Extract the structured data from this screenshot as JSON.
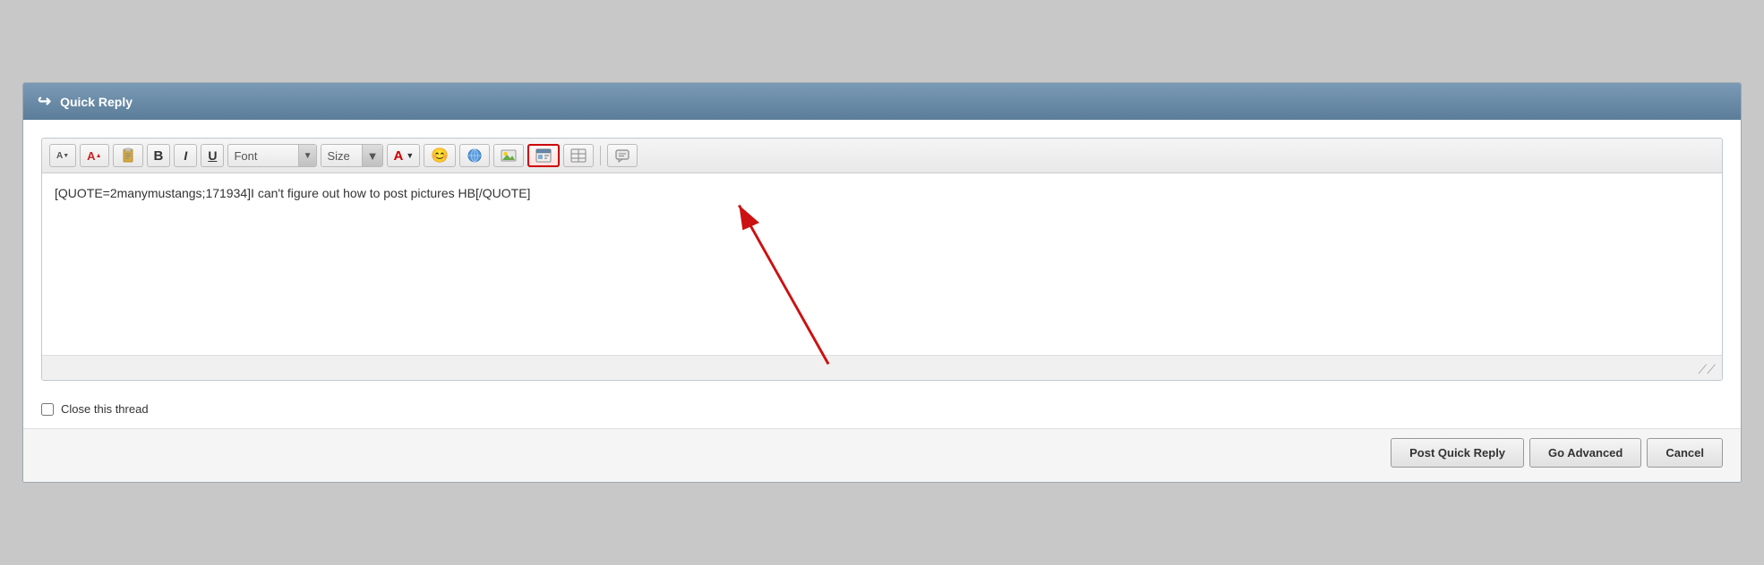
{
  "titleBar": {
    "icon": "↩",
    "title": "Quick Reply"
  },
  "toolbar": {
    "buttons": [
      {
        "name": "decrease-font-btn",
        "label": "A↓",
        "title": "Decrease Font Size"
      },
      {
        "name": "increase-font-btn",
        "label": "A↑",
        "title": "Increase Font Size"
      },
      {
        "name": "format-btn",
        "label": "📋",
        "title": "Format"
      },
      {
        "name": "bold-btn",
        "label": "B",
        "title": "Bold"
      },
      {
        "name": "italic-btn",
        "label": "I",
        "title": "Italic"
      },
      {
        "name": "underline-btn",
        "label": "U",
        "title": "Underline"
      }
    ],
    "fontPlaceholder": "Font",
    "sizePlaceholder": "Size",
    "colorLabel": "A"
  },
  "textArea": {
    "content": "[QUOTE=2manymustangs;171934]I can't figure out how to post pictures HB[/QUOTE]"
  },
  "closeThread": {
    "label": "Close this thread"
  },
  "actions": {
    "postQuickReply": "Post Quick Reply",
    "goAdvanced": "Go Advanced",
    "cancel": "Cancel"
  }
}
